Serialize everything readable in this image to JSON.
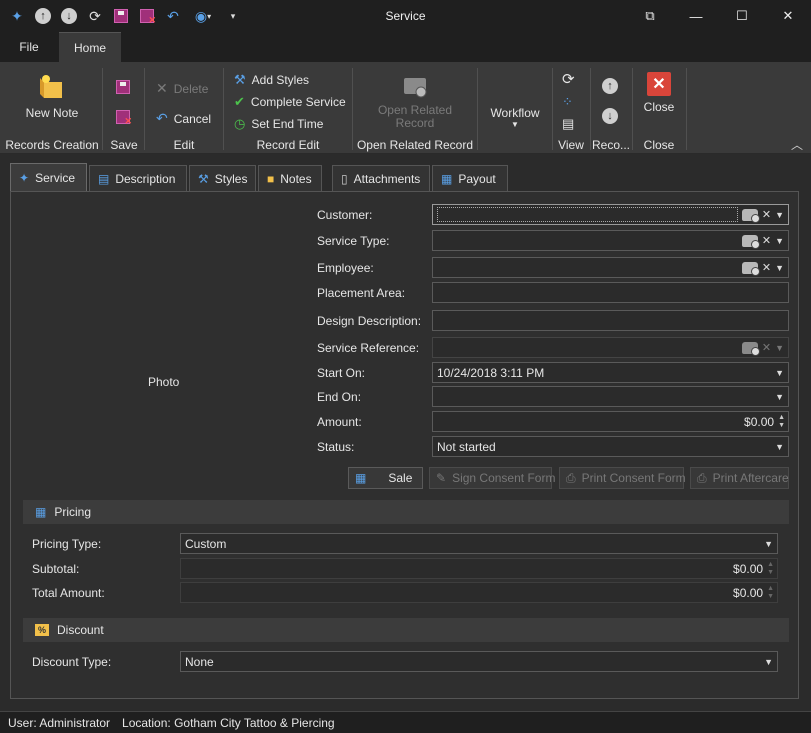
{
  "window": {
    "title": "Service",
    "controls": {
      "restore": "⧉",
      "minimize": "—",
      "maximize": "☐",
      "close": "✕"
    }
  },
  "qat": [
    "wand-icon",
    "up-icon",
    "down-icon",
    "refresh-icon",
    "save-icon",
    "save-close-icon",
    "undo-icon",
    "record-icon",
    "dropdown-icon"
  ],
  "menu_tabs": {
    "file": "File",
    "home": "Home"
  },
  "ribbon": {
    "new_note": "New Note",
    "records_creation": "Records Creation",
    "save_group": "Save",
    "delete": "Delete",
    "cancel": "Cancel",
    "edit_group": "Edit",
    "add_styles": "Add Styles",
    "complete_service": "Complete Service",
    "set_end_time": "Set End Time",
    "record_edit_group": "Record Edit",
    "open_related_record": "Open Related Record",
    "open_related_record_group": "Open Related Record",
    "workflow": "Workflow",
    "view_group": "View",
    "reco_group": "Reco...",
    "close": "Close",
    "close_group": "Close"
  },
  "doc_tabs": {
    "service": "Service",
    "description": "Description",
    "styles": "Styles",
    "notes": "Notes",
    "attachments": "Attachments",
    "payout": "Payout"
  },
  "form": {
    "photo": "Photo",
    "customer_label": "Customer:",
    "service_type_label": "Service Type:",
    "employee_label": "Employee:",
    "placement_area_label": "Placement Area:",
    "design_description_label": "Design Description:",
    "service_reference_label": "Service Reference:",
    "start_on_label": "Start On:",
    "start_on_value": "10/24/2018 3:11 PM",
    "end_on_label": "End On:",
    "amount_label": "Amount:",
    "amount_value": "$0.00",
    "status_label": "Status:",
    "status_value": "Not started"
  },
  "actions": {
    "sale": "Sale",
    "sign_consent_form": "Sign Consent Form",
    "print_consent_form": "Print Consent Form",
    "print_aftercare": "Print Aftercare"
  },
  "pricing": {
    "header": "Pricing",
    "pricing_type_label": "Pricing Type:",
    "pricing_type_value": "Custom",
    "subtotal_label": "Subtotal:",
    "subtotal_value": "$0.00",
    "total_amount_label": "Total Amount:",
    "total_amount_value": "$0.00"
  },
  "discount": {
    "header": "Discount",
    "discount_type_label": "Discount Type:",
    "discount_type_value": "None"
  },
  "statusbar": {
    "user": "User: Administrator",
    "location": "Location: Gotham City Tattoo & Piercing"
  },
  "colors": {
    "background": "#2b2b2b",
    "titlebar": "#1f1f1f",
    "ribbon": "#3a3a3a",
    "accent_close": "#d9453a",
    "accent_blue": "#3a86d8",
    "text": "#e6e6e6",
    "disabled_text": "#7a7a7a"
  }
}
